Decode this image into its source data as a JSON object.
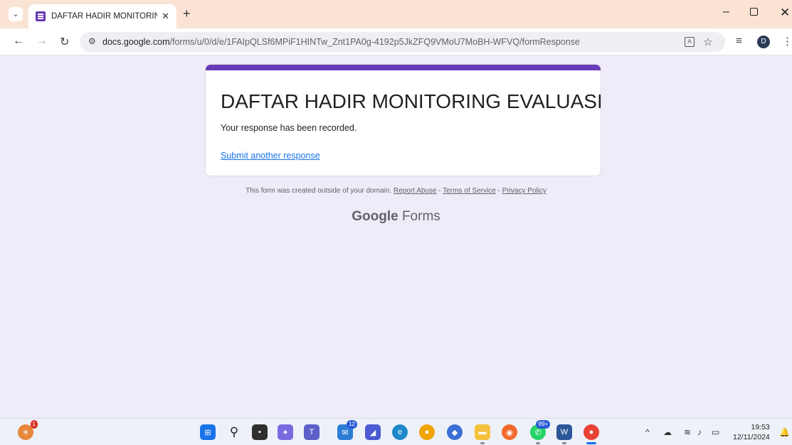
{
  "browser": {
    "tab_title": "DAFTAR HADIR MONITORING E",
    "tab_close": "✕",
    "new_tab": "+",
    "url_host": "docs.google.com",
    "url_path": "/forms/u/0/d/e/1FAIpQLSf6MPiF1HINTw_Znt1PA0g-4192p5JkZFQ9VMoU7MoBH-WFVQ/formResponse",
    "profile_initial": "D"
  },
  "form": {
    "title": "DAFTAR HADIR MONITORING EVALUASI",
    "confirmation": "Your response has been recorded.",
    "submit_another": "Submit another response",
    "accent_color": "#673ab7"
  },
  "footer": {
    "note": "This form was created outside of your domain.",
    "report_abuse": "Report Abuse",
    "sep1": " - ",
    "terms": "Terms of Service",
    "sep2": " - ",
    "privacy": "Privacy Policy",
    "brand_google": "Google",
    "brand_forms": "Forms"
  },
  "taskbar": {
    "weather_badge": "1",
    "mail_badge": "12",
    "whatsapp_badge": "99+",
    "time": "19:53",
    "date": "12/11/2024"
  }
}
